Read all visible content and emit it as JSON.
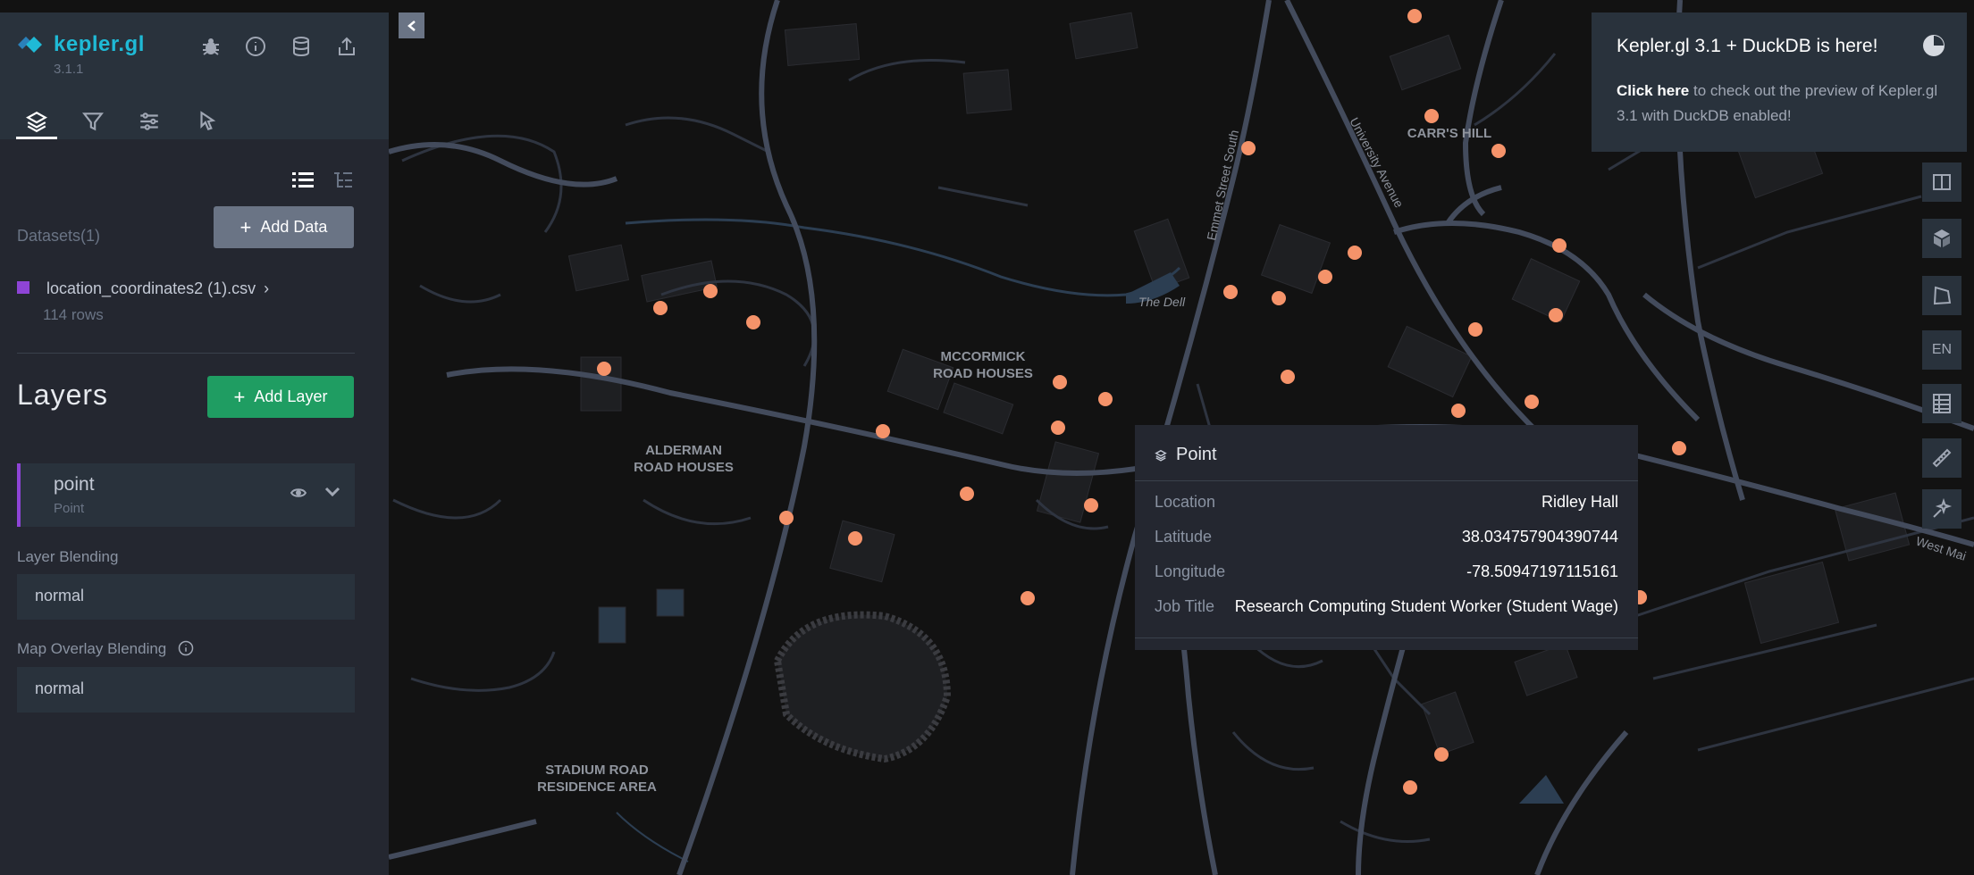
{
  "app": {
    "name": "kepler.gl",
    "version": "3.1.1"
  },
  "sidebar": {
    "header_icons": [
      "bug-icon",
      "info-icon",
      "database-icon",
      "share-icon"
    ],
    "tabs": [
      {
        "name": "layers-icon",
        "active": true
      },
      {
        "name": "filter-icon",
        "active": false
      },
      {
        "name": "sliders-icon",
        "active": false
      },
      {
        "name": "interaction-icon",
        "active": false
      }
    ],
    "datasets_label": "Datasets(1)",
    "add_data_label": "Add Data",
    "dataset": {
      "name": "location_coordinates2 (1).csv",
      "rows": "114 rows",
      "color": "#8e44d6"
    },
    "layers_title": "Layers",
    "add_layer_label": "Add Layer",
    "layer": {
      "name": "point",
      "type": "Point"
    },
    "layer_blending_label": "Layer Blending",
    "layer_blending_value": "normal",
    "map_overlay_label": "Map Overlay Blending",
    "map_overlay_value": "normal"
  },
  "notification": {
    "title": "Kepler.gl 3.1 + DuckDB is here!",
    "link": "Click here",
    "body": " to check out the preview of Kepler.gl 3.1 with DuckDB enabled!"
  },
  "map_controls": [
    "split-map-icon",
    "3d-view-icon",
    "draw-polygon-icon",
    "EN",
    "table-icon",
    "ruler-icon",
    "ai-assistant-icon"
  ],
  "tooltip": {
    "layer_name": "Point",
    "rows": [
      {
        "key": "Location",
        "value": "Ridley Hall"
      },
      {
        "key": "Latitude",
        "value": "38.034757904390744"
      },
      {
        "key": "Longitude",
        "value": "-78.50947197115161"
      },
      {
        "key": "Job Title",
        "value": "Research Computing Student Worker (Student Wage)"
      }
    ]
  },
  "map_labels": {
    "carrs_hill": "CARR'S HILL",
    "mccormick_1": "MCCORMICK",
    "mccormick_2": "ROAD HOUSES",
    "alderman_1": "ALDERMAN",
    "alderman_2": "ROAD HOUSES",
    "stadium_1": "STADIUM ROAD",
    "stadium_2": "RESIDENCE AREA",
    "the_dell": "The Dell",
    "emmet": "Emmet Street South",
    "university": "University Avenue",
    "west_main": "West Mai"
  },
  "colors": {
    "point": "#f5936a",
    "sidebar": "#242730",
    "accent": "#1fbad6",
    "add_layer": "#1f9d62"
  }
}
